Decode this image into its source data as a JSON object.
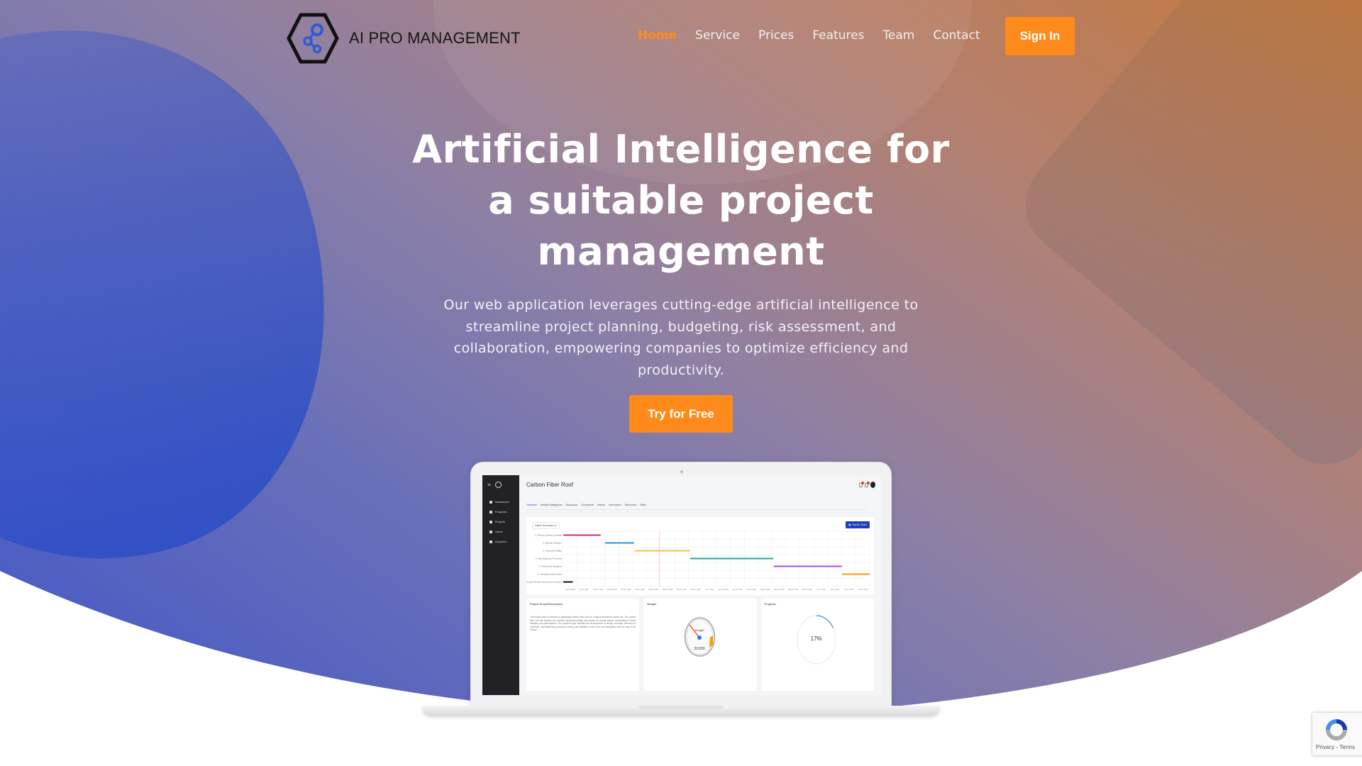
{
  "header": {
    "brand": "AI PRO MANAGEMENT",
    "nav": [
      {
        "label": "Home",
        "active": true
      },
      {
        "label": "Service",
        "active": false
      },
      {
        "label": "Prices",
        "active": false
      },
      {
        "label": "Features",
        "active": false
      },
      {
        "label": "Team",
        "active": false
      },
      {
        "label": "Contact",
        "active": false
      }
    ],
    "sign_in_label": "Sign In"
  },
  "hero": {
    "title": "Artificial Intelligence for a suitable project management",
    "description": "Our web application leverages cutting-edge artificial intelligence to streamline project planning, budgeting, risk assessment, and collaboration, empowering companies to optimize efficiency and productivity.",
    "cta_label": "Try for Free"
  },
  "colors": {
    "accent": "#ff8a1c",
    "active_nav": "#ff8a1f",
    "gradient_start": "#c6793c",
    "gradient_end": "#3e55c8"
  },
  "mockup": {
    "sidebar": [
      "Dashboard",
      "Programs",
      "Projects",
      "Users",
      "Suppliers"
    ],
    "project_title": "Carbon Fiber Roof",
    "tabs": [
      "Overview",
      "Artificial Intelligence",
      "Discussion",
      "Documents",
      "History",
      "Information",
      "Resources",
      "Risks"
    ],
    "active_tab": "Overview",
    "gantt_select": "Gantt Summary",
    "gantt_button": "Gantt Chart",
    "gantt": {
      "tasks": [
        {
          "name": "1. Develop Design Concepts",
          "start": 0,
          "end": 2.7,
          "color": "#e91e63"
        },
        {
          "name": "2. Material Selection",
          "start": 3.0,
          "end": 5.1,
          "color": "#2196f3"
        },
        {
          "name": "3. Structural Design",
          "start": 5.1,
          "end": 9.1,
          "color": "#fbc02d"
        },
        {
          "name": "4. Manufacturing Processes",
          "start": 9.1,
          "end": 15.1,
          "color": "#26a69a"
        },
        {
          "name": "5. Testing and Validation",
          "start": 15.1,
          "end": 20.0,
          "color": "#9c4dff"
        },
        {
          "name": "6. Integration with Vehicle",
          "start": 20.0,
          "end": 22.0,
          "color": "#ff9800"
        },
        {
          "name": "7. Project Review and Lessons Learned",
          "start": 0,
          "end": 0.7,
          "color": "#111111"
        }
      ],
      "today_index": 6.9,
      "dates": [
        "Jan 28, 2024",
        "Feb 4, 2024",
        "Feb 11, 2024",
        "Feb 18, 2024",
        "Feb 25, 2024",
        "Mar 3, 2024",
        "Mar 10, 2024",
        "Mar 17, 2024",
        "Mar 24, 2024",
        "Mar 31, 2024",
        "Apr 7, 2024",
        "Apr 14, 2024",
        "Apr 21, 2024",
        "Apr 28, 2024",
        "May 5, 2024",
        "May 12, 2024",
        "May 19, 2024",
        "May 26, 2024",
        "Jun 2, 2024",
        "Jun 9, 2024",
        "Jun 16, 2024",
        "Jun 23, 2024"
      ]
    },
    "scope_title": "Project Scope/Description",
    "scope_text": "The project aims to develop a lightweight carbon fiber roof for a high performance sports car. The carbon fiber roof will improve the vehicle's structural rigidity and reduce its overall weight, contributing to better handling and performance. The project scope includes the development of design concepts, selection of materials, manufacturing processes, testing and validation of the roof, and integration with the rest of the vehicle.",
    "budget_title": "Budget",
    "budget_gauge_label": "Budget",
    "budget_value": "32,000",
    "progress_title": "Progress",
    "progress_percent": 17,
    "progress_text": "17%"
  },
  "recaptcha": {
    "links": "Privacy - Terms"
  }
}
